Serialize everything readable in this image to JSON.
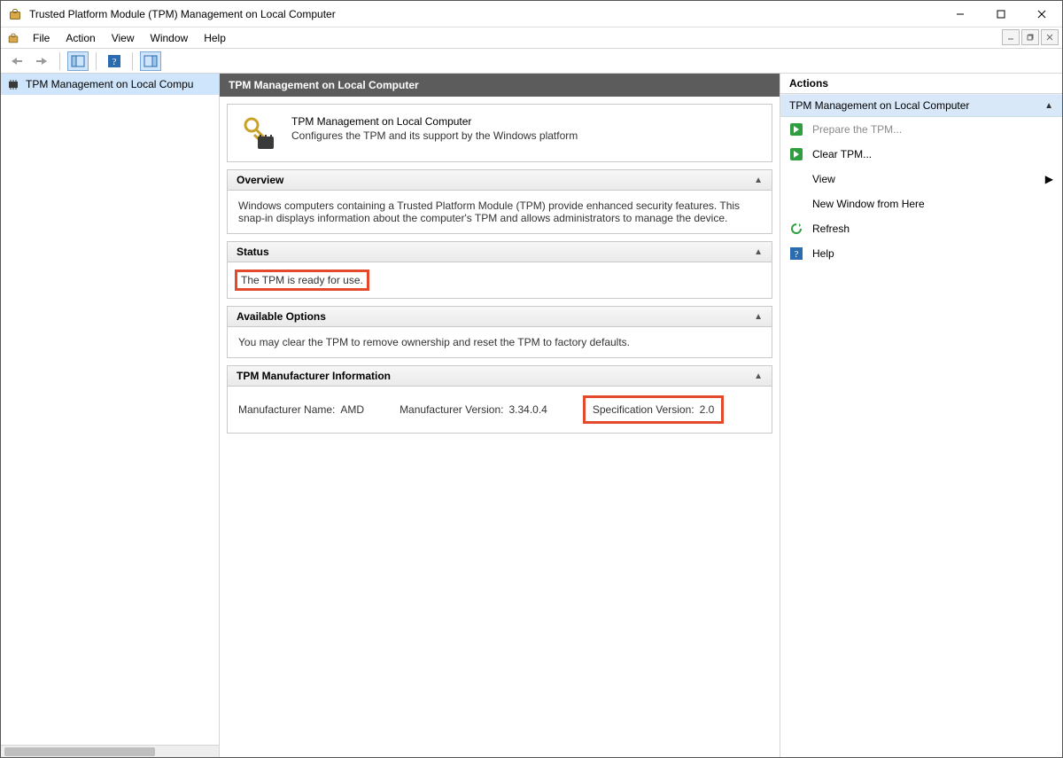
{
  "window": {
    "title": "Trusted Platform Module (TPM) Management on Local Computer"
  },
  "menu": {
    "file": "File",
    "action": "Action",
    "view": "View",
    "window": "Window",
    "help": "Help"
  },
  "tree": {
    "root_label": "TPM Management on Local Compu"
  },
  "center": {
    "header": "TPM Management on Local Computer",
    "intro_title": "TPM Management on Local Computer",
    "intro_desc": "Configures the TPM and its support by the Windows platform",
    "overview": {
      "title": "Overview",
      "body": "Windows computers containing a Trusted Platform Module (TPM) provide enhanced security features. This snap-in displays information about the computer's TPM and allows administrators to manage the device."
    },
    "status": {
      "title": "Status",
      "body": "The TPM is ready for use."
    },
    "options": {
      "title": "Available Options",
      "body": "You may clear the TPM to remove ownership and reset the TPM to factory defaults."
    },
    "mfr": {
      "title": "TPM Manufacturer Information",
      "name_label": "Manufacturer Name:",
      "name_value": "AMD",
      "ver_label": "Manufacturer Version:",
      "ver_value": "3.34.0.4",
      "spec_label": "Specification Version:",
      "spec_value": "2.0"
    }
  },
  "actions": {
    "header": "Actions",
    "section": "TPM Management on Local Computer",
    "prepare": "Prepare the TPM...",
    "clear": "Clear TPM...",
    "view": "View",
    "new_window": "New Window from Here",
    "refresh": "Refresh",
    "help": "Help"
  }
}
